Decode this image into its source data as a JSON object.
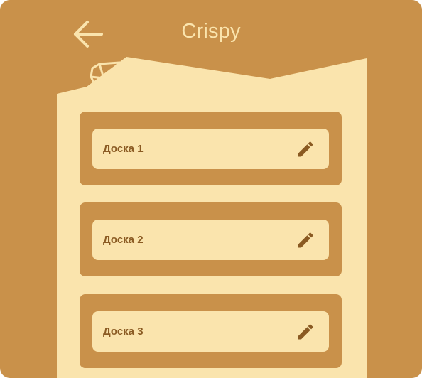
{
  "header": {
    "title": "Crispy",
    "back_icon": "arrow-left-icon"
  },
  "colors": {
    "background": "#c9914a",
    "paper": "#fae4ad",
    "text_dark": "#8a5a22",
    "icon_dark": "#8a5a22"
  },
  "boards": [
    {
      "label": "Доска 1",
      "icon": "pencil-icon"
    },
    {
      "label": "Доска 2",
      "icon": "pencil-icon"
    },
    {
      "label": "Доска 3",
      "icon": "pencil-icon"
    }
  ]
}
